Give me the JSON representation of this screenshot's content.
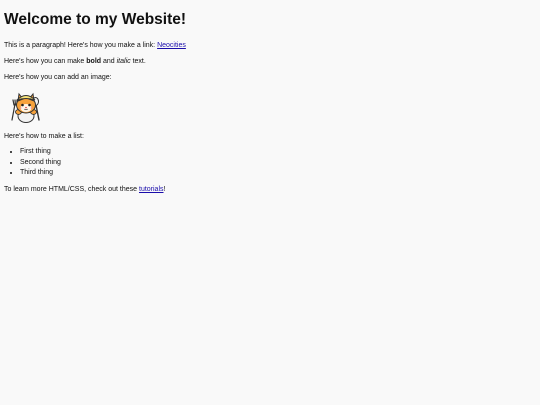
{
  "page": {
    "heading": "Welcome to my Website!",
    "para1": {
      "text": "This is a paragraph! Here's how you make a link: ",
      "link": "Neocities"
    },
    "para2": {
      "before": "Here's how you can make ",
      "bold": "bold",
      "middle": " and ",
      "italic": "italic",
      "after": " text."
    },
    "para3": "Here's how you can add an image:",
    "image": {
      "icon": "neocities-cat-mascot-icon"
    },
    "para4": "Here's how to make a list:",
    "list": [
      "First thing",
      "Second thing",
      "Third thing"
    ],
    "para5": {
      "before": "To learn more HTML/CSS, check out these ",
      "link": "tutorials",
      "after": "!"
    }
  },
  "colors": {
    "background": "#f9f9f9",
    "text": "#111111",
    "link": "#1a0dab"
  }
}
